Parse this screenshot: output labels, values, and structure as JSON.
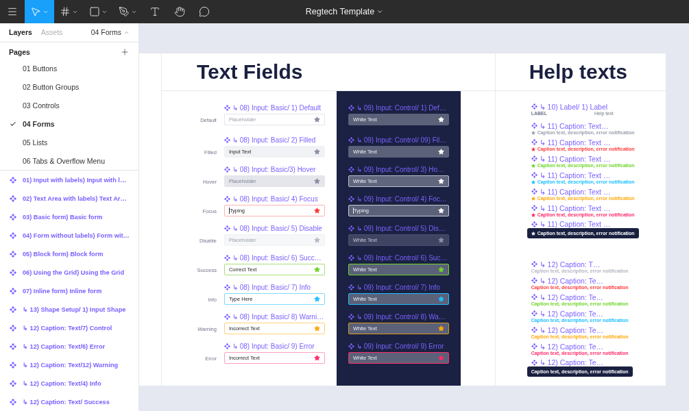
{
  "toolbar": {
    "tools": [
      {
        "kind": "menu",
        "selected": false,
        "dropdown": false
      },
      {
        "kind": "move",
        "selected": true,
        "dropdown": true
      },
      {
        "kind": "frame",
        "selected": false,
        "dropdown": true
      },
      {
        "kind": "shape",
        "selected": false,
        "dropdown": true
      },
      {
        "kind": "pen",
        "selected": false,
        "dropdown": true
      },
      {
        "kind": "text",
        "selected": false,
        "dropdown": false
      },
      {
        "kind": "hand",
        "selected": false,
        "dropdown": false
      },
      {
        "kind": "comment",
        "selected": false,
        "dropdown": false
      }
    ],
    "file_title": "Regtech Template"
  },
  "sidebar": {
    "tabs": [
      {
        "label": "Layers",
        "selected": true
      },
      {
        "label": "Assets",
        "selected": false
      }
    ],
    "page_menu": "04 Forms",
    "pages_heading": "Pages",
    "pages": [
      {
        "label": "01 Buttons",
        "selected": false
      },
      {
        "label": "02 Button Groups",
        "selected": false
      },
      {
        "label": "03 Controls",
        "selected": false
      },
      {
        "label": "04 Forms",
        "selected": true
      },
      {
        "label": "05 Lists",
        "selected": false
      },
      {
        "label": "06 Tabs & Overflow Menu",
        "selected": false
      }
    ],
    "layers": [
      "01) Input with labels) Input with l…",
      "02) Text Area with labels) Text Ar…",
      "03) Basic form) Basic form",
      "04) Form without labels) Form wit…",
      "05) Block form) Block form",
      "06) Using the Grid) Using the Grid",
      "07) Inline form) Inline form",
      "↳ 13) Shape Setup/ 1) Input Shape",
      "↳ 12)  Caption: Text/7) Control",
      "↳ 12)  Caption: Text/6) Error",
      "↳ 12)  Caption: Text/12) Warning",
      "↳ 12)  Caption: Text/4) Info",
      "↳ 12)  Caption: Text/ Success"
    ]
  },
  "canvas": {
    "text_fields": {
      "title": "Text Fields",
      "rows": [
        {
          "kind": "default",
          "state_label": "Default",
          "basic": {
            "title": "↳ 08) Input: Basic/ 1) Default",
            "placeholder": "Placeholder"
          },
          "control": {
            "title": "↳ 09) Input: Control/ 1) Def…",
            "value": "White Text"
          }
        },
        {
          "kind": "filled",
          "state_label": "Filled",
          "basic": {
            "title": "↳ 08) Input: Basic/ 2) Filled",
            "value": "Input Text"
          },
          "control": {
            "title": "↳ 09) Input: Control/ 09) Fil…",
            "value": "White Text"
          }
        },
        {
          "kind": "hover",
          "state_label": "Hover",
          "basic": {
            "title": "↳ 08) Input: Basic/3) Hover",
            "placeholder": "Placeholder"
          },
          "control": {
            "title": "↳ 09) Input: Control/ 3) Ho…",
            "value": "White Text"
          }
        },
        {
          "kind": "focus",
          "state_label": "Focus",
          "basic": {
            "title": "↳ 08) Input: Basic/ 4) Focus",
            "value": "Typing"
          },
          "control": {
            "title": "↳ 09) Input: Control/ 4) Foc…",
            "value": "Typing"
          }
        },
        {
          "kind": "disable",
          "state_label": "Disable",
          "basic": {
            "title": "↳ 08) Input: Basic/ 5) Disable",
            "placeholder": "Placeholder"
          },
          "control": {
            "title": "↳ 09) Input: Control/ 5) Dis…",
            "value": "White Text"
          }
        },
        {
          "kind": "success",
          "state_label": "Success",
          "basic": {
            "title": "↳ 08) Input: Basic/ 6) Succ…",
            "value": "Correct Text"
          },
          "control": {
            "title": "↳ 09) Input: Control/ 6) Suc…",
            "value": "White Text"
          }
        },
        {
          "kind": "info",
          "state_label": "Info",
          "basic": {
            "title": "↳ 08) Input: Basic/ 7) Info",
            "value": "Type Here"
          },
          "control": {
            "title": "↳ 09) Input: Control/ 7) Info",
            "value": "White Text"
          }
        },
        {
          "kind": "warning",
          "state_label": "Warning",
          "basic": {
            "title": "↳ 08) Input: Basic/ 8) Warni…",
            "value": "Incorrect Text"
          },
          "control": {
            "title": "↳ 09) Input: Control/ 8) Wa…",
            "value": "White Text"
          }
        },
        {
          "kind": "error",
          "state_label": "Error",
          "basic": {
            "title": "↳ 08) Input: Basic/ 9) Error",
            "value": "Incorrect Text"
          },
          "control": {
            "title": "↳ 09) Input: Control/ 9) Error",
            "value": "White Text"
          }
        }
      ]
    },
    "help_texts": {
      "title": "Help texts",
      "label_item": {
        "title": "↳ 10) Label/ 1) Label",
        "label": "LABEL",
        "help": "Help text"
      },
      "captions_with_icon": [
        {
          "kind": "plain",
          "title": "↳ 11)  Caption: Text…",
          "caption": "Caption text, description, error notification",
          "color": "#9aa0ae"
        },
        {
          "kind": "plain",
          "title": "↳ 11)  Caption: Text …",
          "caption": "Caption text, description, error notification",
          "color": "#ff3b3b"
        },
        {
          "kind": "plain",
          "title": "↳ 11)  Caption: Text …",
          "caption": "Caption text, description, error notification",
          "color": "#6fd62c"
        },
        {
          "kind": "plain",
          "title": "↳ 11)  Caption: Text …",
          "caption": "Caption text, description, error notification",
          "color": "#1ec0ff"
        },
        {
          "kind": "plain",
          "title": "↳ 11)  Caption: Text …",
          "caption": "Caption text, description, error notification",
          "color": "#ffa90a"
        },
        {
          "kind": "plain",
          "title": "↳ 11)  Caption: Text …",
          "caption": "Caption text, description, error notification",
          "color": "#ff2a6a"
        },
        {
          "kind": "control",
          "title": "↳ 11)  Caption: Text …",
          "caption": "Caption text, description, error notification",
          "color": "#ffffff"
        }
      ],
      "captions": [
        {
          "kind": "plain",
          "title": "↳ 12)  Caption: T…",
          "caption": "Caption text, description, error notification",
          "color": "#b4b8c4"
        },
        {
          "kind": "plain",
          "title": "↳ 12)  Caption: Te…",
          "caption": "Caption text, description, error notification",
          "color": "#ff3b3b"
        },
        {
          "kind": "plain",
          "title": "↳ 12)  Caption: Te…",
          "caption": "Caption text, description, error notification",
          "color": "#6fd62c"
        },
        {
          "kind": "plain",
          "title": "↳ 12)  Caption: Te…",
          "caption": "Caption text, description, error notification",
          "color": "#1ec0ff"
        },
        {
          "kind": "plain",
          "title": "↳ 12)  Caption: Te…",
          "caption": "Caption text, description, error notification",
          "color": "#ffa90a"
        },
        {
          "kind": "plain",
          "title": "↳ 12)  Caption: Te…",
          "caption": "Caption text, description, error notification",
          "color": "#ff2a6a"
        },
        {
          "kind": "control",
          "title": "↳ 12)  Caption: Te…",
          "caption": "Caption text, description, error notification",
          "color": "#ffffff"
        }
      ]
    }
  }
}
